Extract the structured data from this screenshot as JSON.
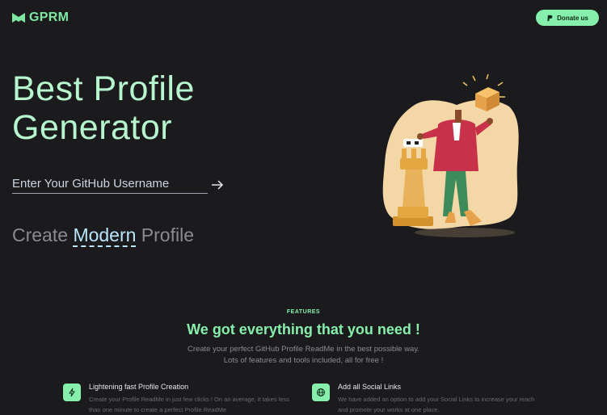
{
  "header": {
    "logo_text": "GPRM",
    "donate_label": "Donate us"
  },
  "hero": {
    "title_line1": "Best Profile",
    "title_line2": "Generator",
    "input_placeholder": "Enter Your GitHub Username",
    "tagline_prefix": "Create ",
    "tagline_highlight": "Modern",
    "tagline_suffix": " Profile"
  },
  "features": {
    "label": "FEATURES",
    "heading": "We got everything that you need !",
    "subtitle_line1": "Create your perfect GitHub Profile ReadMe in the best possible way.",
    "subtitle_line2": "Lots of features and tools included, all for free !",
    "items": [
      {
        "icon": "lightning-icon",
        "title": "Lightening fast Profile Creation",
        "description": "Create your Profile ReadMe in just few clicks ! On an average, it takes less than one minute to create a perfect Profile ReadMe"
      },
      {
        "icon": "globe-icon",
        "title": "Add all Social Links",
        "description": "We have added an option to add your Social Links to increase your reach and promote your works at one place."
      }
    ]
  },
  "colors": {
    "background": "#1b1b1d",
    "accent_green": "#86efac",
    "title_green": "#b7f5cf",
    "highlight_blue": "#bae6fd"
  }
}
